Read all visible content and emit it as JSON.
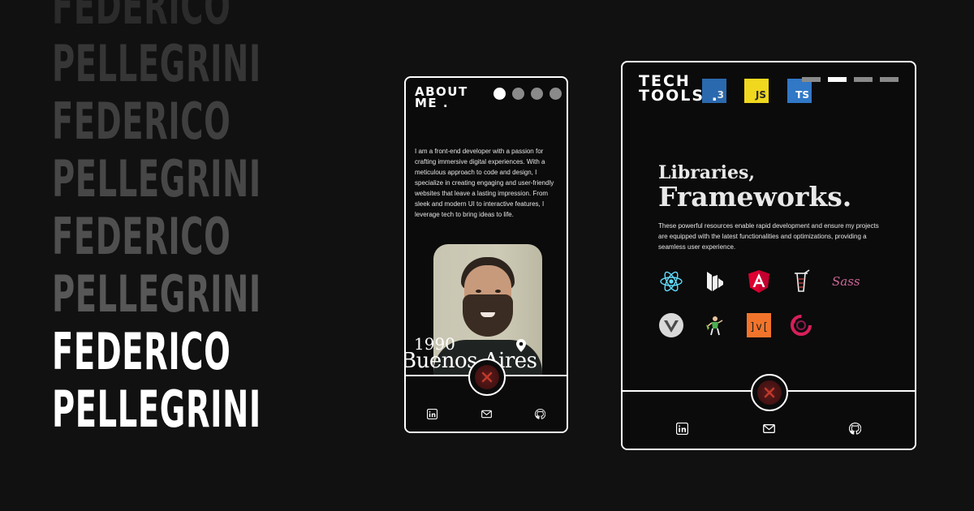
{
  "hero": {
    "lines": [
      "FEDERICO",
      "PELLEGRINI",
      "FEDERICO",
      "PELLEGRINI",
      "FEDERICO",
      "PELLEGRINI",
      "FEDERICO",
      "PELLEGRINI"
    ]
  },
  "phone": {
    "title_line1": "ABOUT",
    "title_line2": "ME .",
    "about_text": "I am a front-end developer with a passion for crafting immersive digital experiences. With a meticulous approach to code and design, I specialize in creating engaging and user-friendly websites that leave a lasting impression. From sleek and modern UI to interactive features, I leverage tech to bring ideas to life.",
    "year": "1990",
    "city": "Buenos Aires"
  },
  "tablet": {
    "title_line1": "TECH",
    "title_line2": "TOOLS .",
    "badges": {
      "css": "3",
      "js": "JS",
      "ts": "TS"
    },
    "heading_line1": "Libraries,",
    "heading_line2": "Frameworks.",
    "description": "These powerful resources enable rapid development and ensure my projects are equipped with the latest functionalities and optimizations, providing a seamless user experience.",
    "sass_label": "Sass",
    "mithril_label": "]v["
  },
  "colors": {
    "background": "#111111",
    "accent_red": "#c0392b",
    "white": "#ffffff"
  },
  "icons": [
    "linkedin-icon",
    "mail-icon",
    "github-icon",
    "location-pin-icon",
    "close-x-icon",
    "react-icon",
    "webflow-icon",
    "angular-icon",
    "gulp-icon",
    "sass-icon",
    "vuetify-icon",
    "jest-icon",
    "mithril-icon",
    "redux-saga-icon",
    "css3-icon",
    "javascript-icon",
    "typescript-icon"
  ]
}
